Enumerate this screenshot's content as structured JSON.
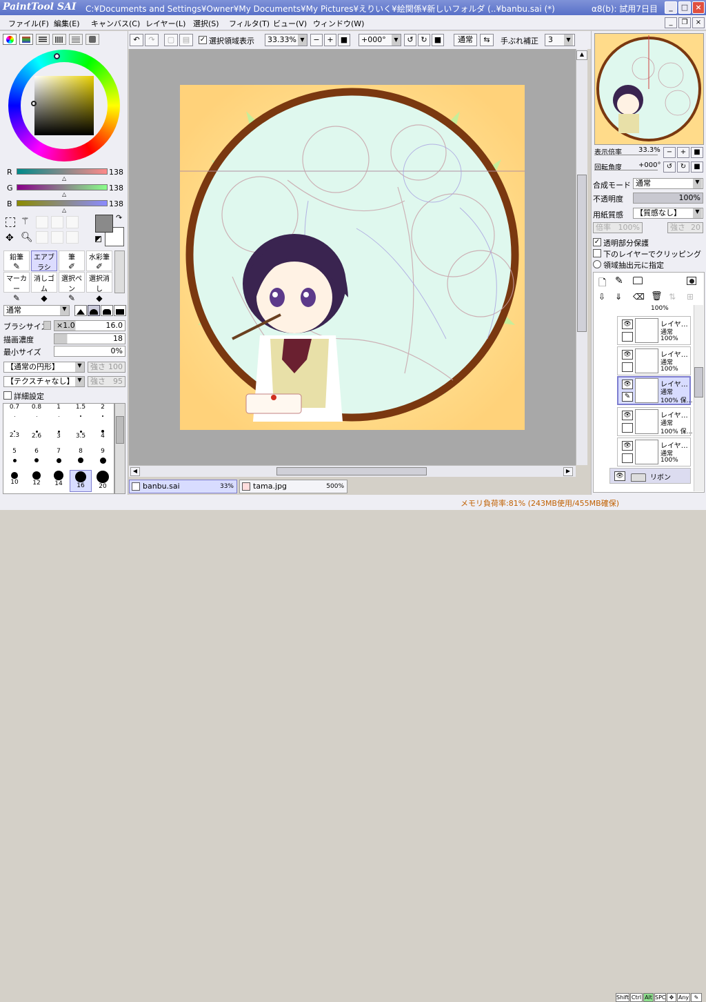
{
  "app": {
    "logo_text": "PaintTool SAI",
    "title": "C:¥Documents and Settings¥Owner¥My Documents¥My Pictures¥えりいく¥絵関係¥新しいフォルダ (..¥banbu.sai (*)",
    "trial": "α8(b): 試用7日目"
  },
  "menu": [
    "ファイル(F)",
    "編集(E)",
    "キャンバス(C)",
    "レイヤー(L)",
    "選択(S)",
    "フィルタ(T)",
    "ビュー(V)",
    "ウィンドウ(W)"
  ],
  "toolbar": {
    "selection_display": "選択領域表示",
    "zoom": "33.33%",
    "rotation": "+000°",
    "blend": "通常",
    "stabilizer_label": "手ぶれ補正",
    "stabilizer_value": "3"
  },
  "color": {
    "r_label": "R",
    "r_value": "138",
    "g_label": "G",
    "g_value": "138",
    "b_label": "B",
    "b_value": "138",
    "fg": "#8a8a8a",
    "bg": "#ffffff"
  },
  "tools": [
    "鉛筆",
    "エアブラシ",
    "筆",
    "水彩筆",
    "マーカー",
    "消しゴム",
    "選択ペン",
    "選択消し"
  ],
  "brush": {
    "mode": "通常",
    "size_label": "ブラシサイズ",
    "size_mult": "×1.0",
    "size_value": "16.0",
    "density_label": "描画濃度",
    "density_value": "18",
    "min_size_label": "最小サイズ",
    "min_size_value": "0%",
    "shape": "【通常の円形】",
    "shape_strength_label": "強さ",
    "shape_strength": "100",
    "texture": "【テクスチャなし】",
    "texture_strength_label": "強さ",
    "texture_strength": "95",
    "detail": "詳細設定"
  },
  "brush_sizes": [
    "0.7",
    "0.8",
    "1",
    "1.5",
    "2",
    "2.3",
    "2.6",
    "3",
    "3.5",
    "4",
    "5",
    "6",
    "7",
    "8",
    "9",
    "10",
    "12",
    "14",
    "16",
    "20"
  ],
  "navigator": {
    "zoom_label": "表示倍率",
    "zoom_value": "33.3%",
    "rotation_label": "回転角度",
    "rotation_value": "+000°"
  },
  "layer_props": {
    "blend_label": "合成モード",
    "blend_value": "通常",
    "opacity_label": "不透明度",
    "opacity_value": "100%",
    "paper_label": "用紙質感",
    "paper_value": "【質感なし】",
    "scale_label": "倍率",
    "scale_value": "100%",
    "strength_label": "強さ",
    "strength_value": "20",
    "protect_alpha": "透明部分保護",
    "clipping": "下のレイヤーでクリッピング",
    "selection_source": "領域抽出元に指定"
  },
  "layers": [
    {
      "name": "レイヤ…",
      "mode": "通常",
      "opacity": "100%"
    },
    {
      "name": "レイヤ…",
      "mode": "通常",
      "opacity": "100%"
    },
    {
      "name": "レイヤ…",
      "mode": "通常",
      "opacity": "100% 保…"
    },
    {
      "name": "レイヤ…",
      "mode": "通常",
      "opacity": "100% 保…"
    },
    {
      "name": "レイヤ…",
      "mode": "通常",
      "opacity": "100%"
    }
  ],
  "layer_top_opacity": "100%",
  "folder": {
    "name": "リボン"
  },
  "docs": [
    {
      "name": "banbu.sai",
      "zoom": "33%"
    },
    {
      "name": "tama.jpg",
      "zoom": "500%"
    }
  ],
  "status": {
    "memory": "メモリ負荷率:81% (243MB使用/455MB確保)",
    "keys": [
      "Shift",
      "Ctrl",
      "Alt",
      "SPC",
      "Any"
    ]
  }
}
